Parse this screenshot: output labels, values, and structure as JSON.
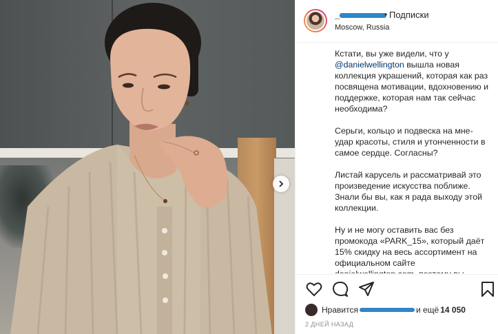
{
  "post": {
    "header": {
      "username": "_",
      "separator": "•",
      "follow_label": "Подписки",
      "location": "Moscow, Russia"
    },
    "caption": {
      "p1_before": "Кстати, вы уже видели, что у ",
      "mention": "@danielwellington",
      "p1_after": " вышла новая коллекция украшений, которая как раз посвящена мотивации, вдохновению и поддержке, которая нам так сейчас необходима?",
      "p2": "Серьги, кольцо и подвеска на мне- удар красоты, стиля и утонченности в самое сердце. Согласны?",
      "p3": "Листай карусель и рассматривай это произведение искусства поближе. Знали бы вы, как я рада выходу этой коллекции.",
      "p4": "Ну и не могу оставить вас без промокода «PARK_15», который даёт 15% скидку на весь ассортимент на официальном сайте danielwellington.com, поэтому вы"
    },
    "likes": {
      "prefix": "Нравится",
      "middle": "и ещё",
      "count": "14 050"
    },
    "time": "2 ДНЕЙ НАЗАД"
  },
  "icons": {
    "like": "heart-icon",
    "comment": "comment-icon",
    "share": "paper-plane-icon",
    "save": "bookmark-icon",
    "carousel": "chevron-right-icon"
  }
}
